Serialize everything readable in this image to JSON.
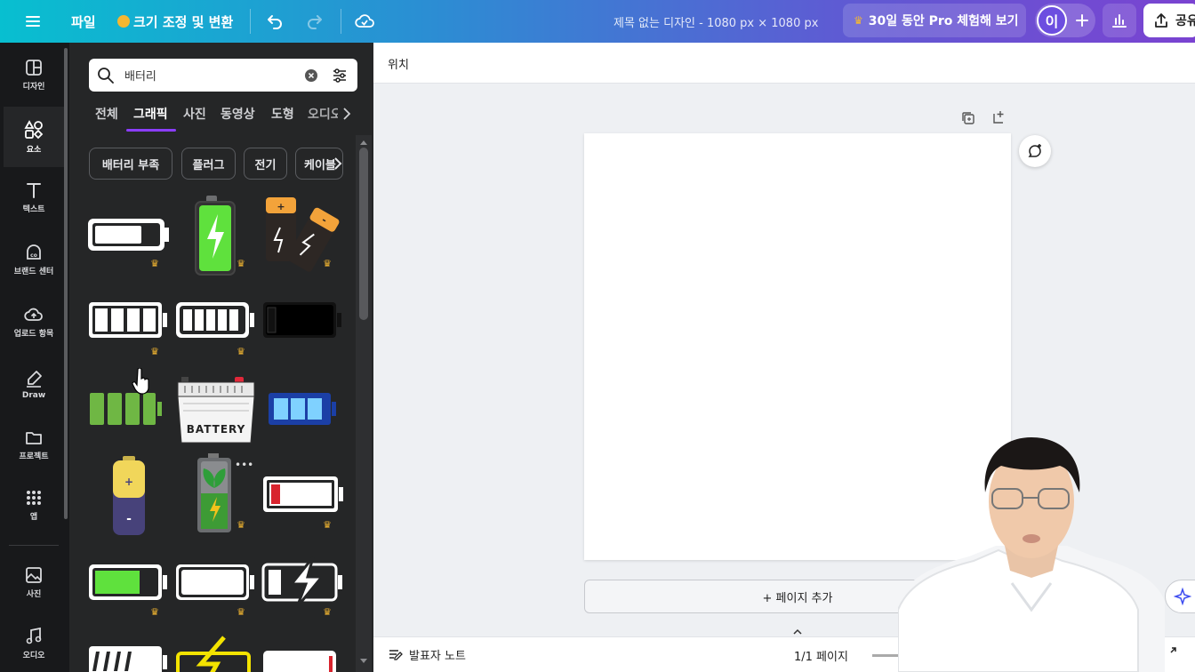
{
  "topbar": {
    "file_menu": "파일",
    "resize_label": "크기 조정 및 변환",
    "doc_title": "제목 없는 디자인 - 1080 px × 1080 px",
    "pro_trial": "30일 동안 Pro 체험해 보기",
    "avatar_initial": "이",
    "share_label": "공유",
    "icons": [
      "menu-icon",
      "crown-icon",
      "undo-icon",
      "redo-icon",
      "cloud-check-icon",
      "plus-icon",
      "analytics-icon",
      "share-icon"
    ]
  },
  "sidebar": {
    "items": [
      {
        "label": "디자인",
        "icon": "design-icon"
      },
      {
        "label": "요소",
        "icon": "elements-icon"
      },
      {
        "label": "텍스트",
        "icon": "text-icon"
      },
      {
        "label": "브랜드 센터",
        "icon": "brand-icon"
      },
      {
        "label": "업로드 항목",
        "icon": "upload-icon"
      },
      {
        "label": "Draw",
        "icon": "draw-icon"
      },
      {
        "label": "프로젝트",
        "icon": "folder-icon"
      },
      {
        "label": "앱",
        "icon": "apps-icon"
      },
      {
        "label": "사진",
        "icon": "photo-icon"
      },
      {
        "label": "오디오",
        "icon": "audio-icon"
      }
    ]
  },
  "panel": {
    "search_value": "배터리",
    "tabs": [
      "전체",
      "그래픽",
      "사진",
      "동영상",
      "도형",
      "오디오"
    ],
    "active_tab": "그래픽",
    "chips": [
      "배터리 부족",
      "플러그",
      "전기",
      "케이블"
    ],
    "battery_text": "BATTERY",
    "crown_glyph": "♛"
  },
  "workspace": {
    "position_label": "위치",
    "add_page": "+ 페이지 추가",
    "notes_label": "발표자 노트",
    "page_counter": "1/1 페이지"
  },
  "colors": {
    "accent": "#8b3dff",
    "panel_bg": "#252627",
    "rail_bg": "#18191b",
    "crown": "#f4b731",
    "battery_green": "#5fe13d"
  }
}
